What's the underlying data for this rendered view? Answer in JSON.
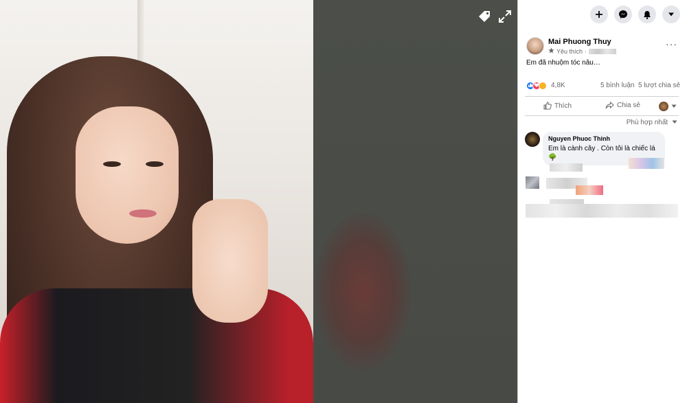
{
  "viewer": {
    "icons": {
      "tag": "tag-icon",
      "fullscreen": "fullscreen-icon"
    }
  },
  "panel": {
    "top_buttons": [
      "plus-icon",
      "messenger-icon",
      "bell-icon",
      "caret-down-icon"
    ],
    "post": {
      "author": "Mai Phuong Thuy",
      "privacy_label": "Yêu thích",
      "separator": "·",
      "more": "···",
      "caption": "Em đã nhuộm tóc nâu…"
    },
    "stats": {
      "reaction_count": "4,8K",
      "comments": "5 bình luận",
      "shares": "5 lượt chia sẻ"
    },
    "actions": {
      "like": "Thích",
      "share": "Chia sẻ"
    },
    "sort_label": "Phù hợp nhất",
    "comment": {
      "author": "Nguyen Phuoc Thinh",
      "text": "Em là cành cây . Còn tôi là chiếc lá",
      "emoji": "🌳"
    }
  },
  "colors": {
    "accent": "#1877f2",
    "viewer_bg": "#4a4d48",
    "bubble_bg": "#f0f2f5"
  }
}
